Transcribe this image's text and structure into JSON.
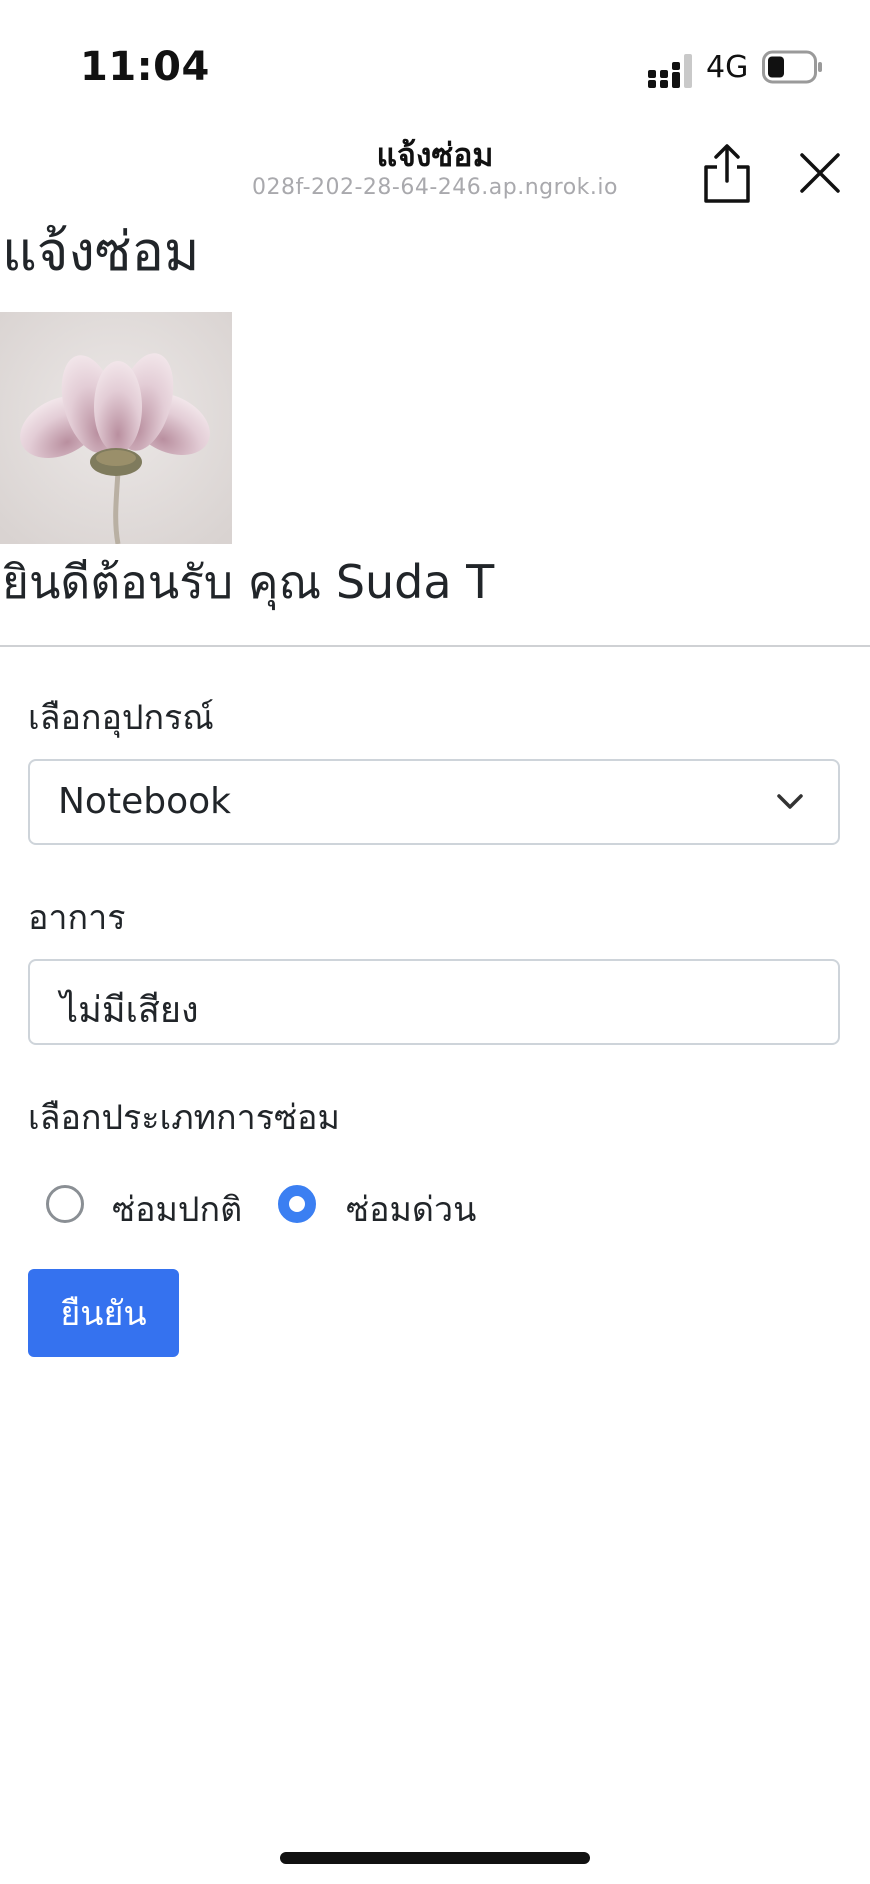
{
  "status_bar": {
    "time": "11:04",
    "network": "4G"
  },
  "browser": {
    "title": "แจ้งซ่อม",
    "url": "028f-202-28-64-246.ap.ngrok.io",
    "share_icon": "share-icon",
    "close_icon": "close-icon"
  },
  "page": {
    "heading": "แจ้งซ่อม",
    "welcome": "ยินดีต้อนรับ คุณ Suda T"
  },
  "form": {
    "device_label": "เลือกอุปกรณ์",
    "device_value": "Notebook",
    "symptom_label": "อาการ",
    "symptom_value": "ไม่มีเสียง",
    "repair_type_label": "เลือกประเภทการซ่อม",
    "repair_options": [
      {
        "label": "ซ่อมปกติ",
        "selected": false
      },
      {
        "label": "ซ่อมด่วน",
        "selected": true
      }
    ],
    "submit_label": "ยืนยัน"
  },
  "colors": {
    "accent": "#3572ef",
    "radio_selected": "#3b7ff2",
    "border": "#ced4da"
  }
}
